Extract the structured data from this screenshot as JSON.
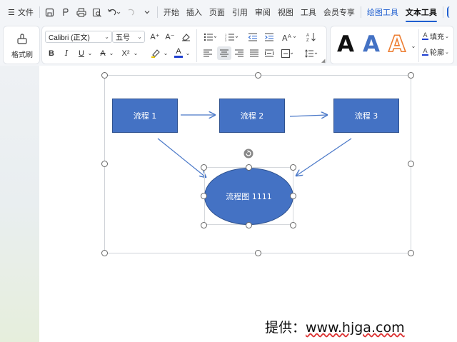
{
  "menubar": {
    "hamburger_icon": "☰",
    "file_label": "文件",
    "tabs": [
      "开始",
      "插入",
      "页面",
      "引用",
      "审阅",
      "视图",
      "工具",
      "会员专享"
    ],
    "drawing_tools_label": "绘图工具",
    "text_tools_label": "文本工具"
  },
  "ribbon": {
    "format_painter_label": "格式刷",
    "font_name": "Calibri (正文)",
    "font_size": "五号",
    "bold": "B",
    "italic": "I",
    "underline": "U",
    "strike": "A",
    "superscript": "X²",
    "font_color_letter": "A",
    "grow_font": "A⁺",
    "shrink_font": "A⁻",
    "wordart_a": "A",
    "fill_label": "填充",
    "outline_label": "轮廓",
    "colors": {
      "accent": "#1f5fd0",
      "shape_fill": "#4472c4",
      "shape_border": "#2f528f",
      "wordart_orange": "#ed7d31",
      "font_color_bar": "#1f3fd0"
    }
  },
  "diagram": {
    "box1": "流程 1",
    "box2": "流程 2",
    "box3": "流程 3",
    "ellipse": "流程图 1111"
  },
  "watermark": {
    "prefix": "提供：",
    "url": "www.hjga.com"
  }
}
